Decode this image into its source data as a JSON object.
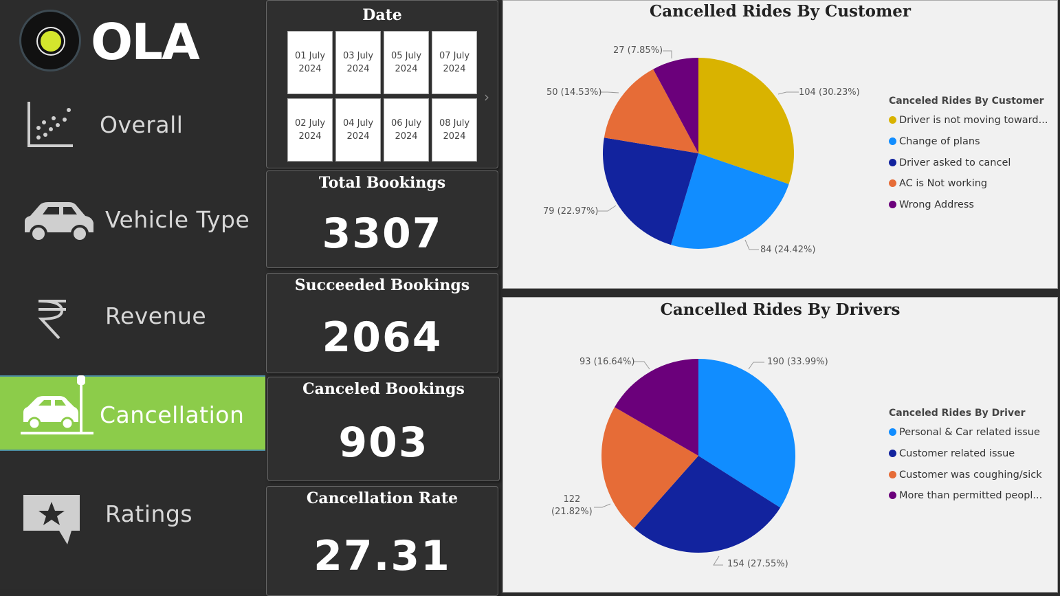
{
  "logo": {
    "text": "OLA"
  },
  "nav": [
    {
      "key": "overall",
      "label": "Overall",
      "icon": "scatter-chart-icon"
    },
    {
      "key": "vehicle",
      "label": "Vehicle Type",
      "icon": "car-icon"
    },
    {
      "key": "revenue",
      "label": "Revenue",
      "icon": "rupee-icon"
    },
    {
      "key": "cancellation",
      "label": "Cancellation",
      "icon": "car-crash-icon",
      "active": true
    },
    {
      "key": "ratings",
      "label": "Ratings",
      "icon": "star-chat-icon"
    }
  ],
  "date_slicer": {
    "title": "Date",
    "tiles": [
      {
        "line1": "01 July",
        "line2": "2024"
      },
      {
        "line1": "03 July",
        "line2": "2024"
      },
      {
        "line1": "05 July",
        "line2": "2024"
      },
      {
        "line1": "07 July",
        "line2": "2024"
      },
      {
        "line1": "02 July",
        "line2": "2024"
      },
      {
        "line1": "04 July",
        "line2": "2024"
      },
      {
        "line1": "06 July",
        "line2": "2024"
      },
      {
        "line1": "08 July",
        "line2": "2024"
      }
    ],
    "arrow": "›"
  },
  "kpis": {
    "total": {
      "title": "Total Bookings",
      "value": "3307"
    },
    "succeeded": {
      "title": "Succeeded Bookings",
      "value": "2064"
    },
    "canceled": {
      "title": "Canceled Bookings",
      "value": "903"
    },
    "rate": {
      "title": "Cancellation Rate",
      "value": "27.31"
    }
  },
  "chart_data": [
    {
      "type": "pie",
      "title": "Cancelled Rides By Customer",
      "legend_title": "Canceled Rides By Customer",
      "legend_position": "right",
      "slices": [
        {
          "name": "Driver is not moving toward...",
          "value": 104,
          "label": "104 (30.23%)",
          "color": "#d9b300"
        },
        {
          "name": "Change of plans",
          "value": 84,
          "label": "84 (24.42%)",
          "color": "#118dff"
        },
        {
          "name": "Driver asked to cancel",
          "value": 79,
          "label": "79 (22.97%)",
          "color": "#12239e"
        },
        {
          "name": "AC is Not working",
          "value": 50,
          "label": "50 (14.53%)",
          "color": "#e66c37"
        },
        {
          "name": "Wrong Address",
          "value": 27,
          "label": "27 (7.85%)",
          "color": "#6b007b"
        }
      ]
    },
    {
      "type": "pie",
      "title": "Cancelled Rides By Drivers",
      "legend_title": "Canceled Rides By Driver",
      "legend_position": "right",
      "slices": [
        {
          "name": "Personal & Car related issue",
          "value": 190,
          "label": "190 (33.99%)",
          "color": "#118dff"
        },
        {
          "name": "Customer related issue",
          "value": 154,
          "label": "154 (27.55%)",
          "color": "#12239e"
        },
        {
          "name": "Customer was coughing/sick",
          "value": 122,
          "label": "122 (21.82%)",
          "label_lines": [
            "122",
            "(21.82%)"
          ],
          "color": "#e66c37"
        },
        {
          "name": "More than permitted peopl...",
          "value": 93,
          "label": "93 (16.64%)",
          "color": "#6b007b"
        }
      ]
    }
  ]
}
